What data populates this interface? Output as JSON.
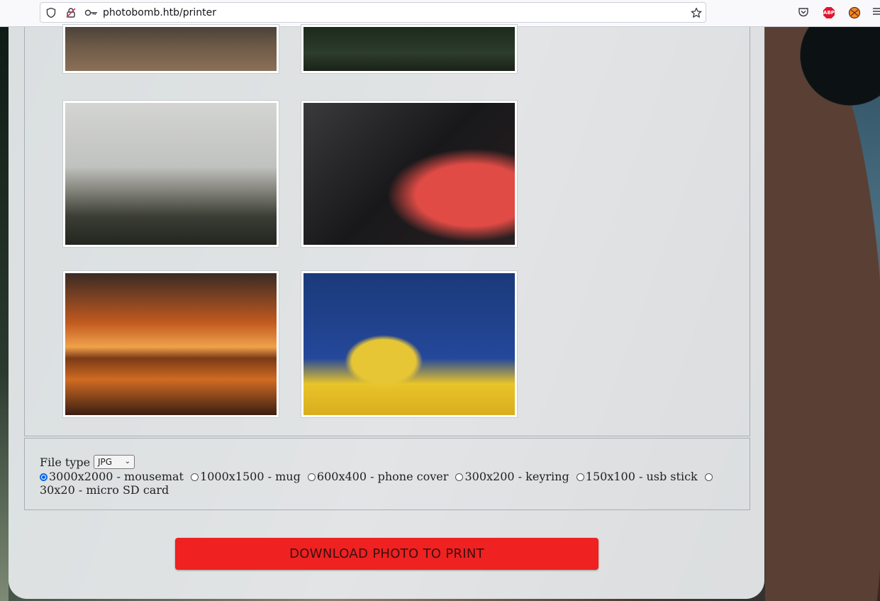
{
  "browser": {
    "url": "photobomb.htb/printer",
    "icons": [
      "shield-icon",
      "insecure-lock-icon",
      "key-icon",
      "bookmark-star-icon",
      "pocket-icon",
      "adblock-icon",
      "extension-icon",
      "menu-icon"
    ],
    "adblock_label": "ABP"
  },
  "gallery": {
    "photos": [
      {
        "name": "tools-on-workbench"
      },
      {
        "name": "ferns-in-forest"
      },
      {
        "name": "misty-coastline"
      },
      {
        "name": "red-glass-curves"
      },
      {
        "name": "boat-at-sunset"
      },
      {
        "name": "yellow-tree-blue-sky"
      }
    ]
  },
  "options": {
    "file_type_label": "File type",
    "file_type_value": "JPG",
    "sizes": [
      {
        "label": "3000x2000 - mousemat",
        "checked": true
      },
      {
        "label": "1000x1500 - mug",
        "checked": false
      },
      {
        "label": "600x400 - phone cover",
        "checked": false
      },
      {
        "label": "300x200 - keyring",
        "checked": false
      },
      {
        "label": "150x100 - usb stick",
        "checked": false
      },
      {
        "label": "30x20 - micro SD card",
        "checked": false
      }
    ]
  },
  "download_button": "DOWNLOAD PHOTO TO PRINT",
  "colors": {
    "button": "#ef2121",
    "radio_accent": "#0b66e4"
  }
}
